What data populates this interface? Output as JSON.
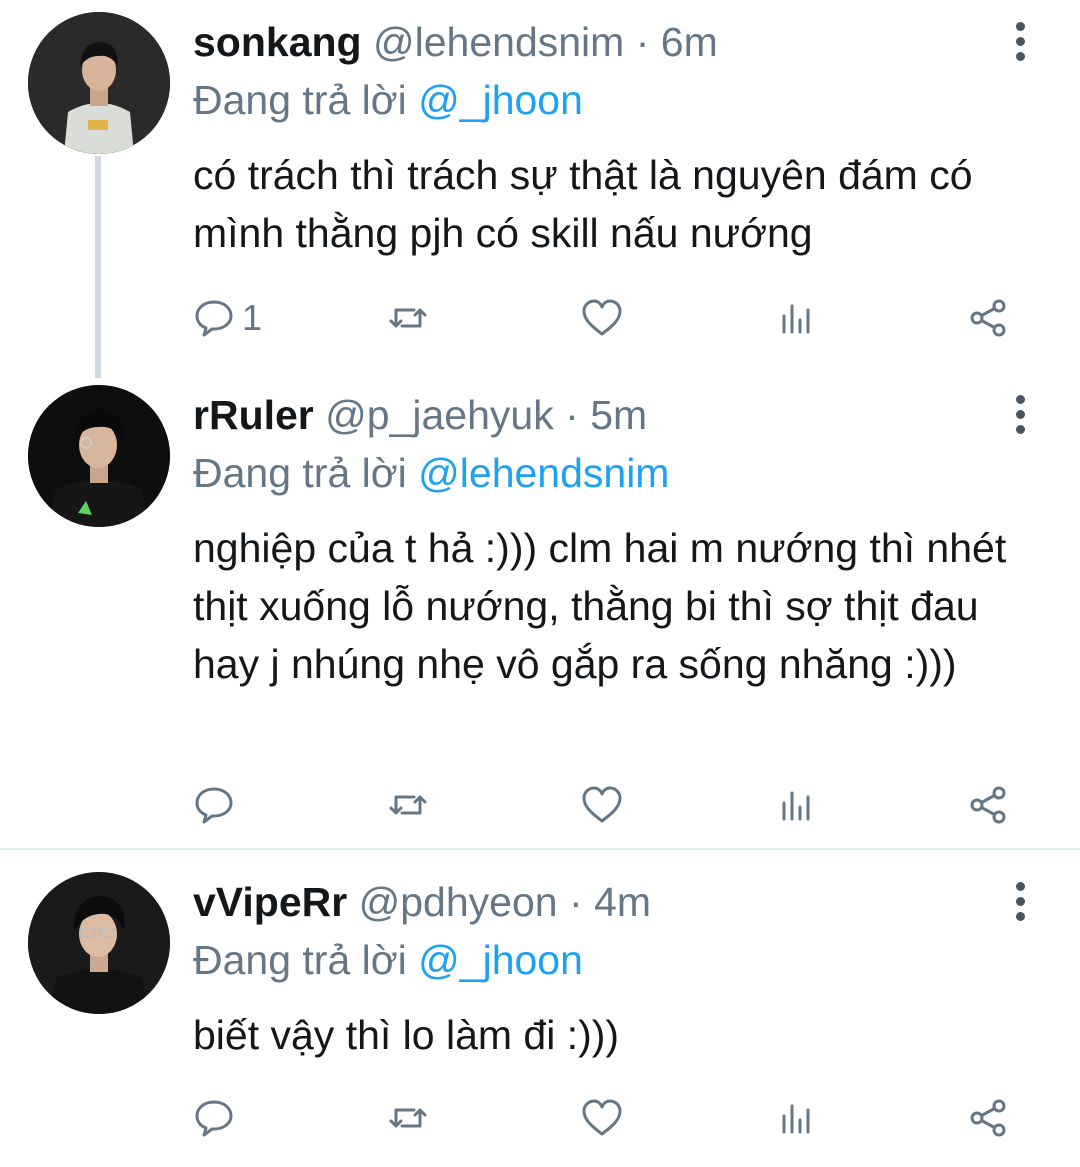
{
  "tweets": [
    {
      "name": "sonkang",
      "handle": "@lehendsnim",
      "dot": "·",
      "time": "6m",
      "replying_prefix": "Đang trả lời",
      "replying_to": "@_jhoon",
      "text": "có trách thì trách sự thật là nguyên đám có mình thằng pjh có skill nấu nướng",
      "reply_count": "1"
    },
    {
      "name": "rRuler",
      "handle": "@p_jaehyuk",
      "dot": "·",
      "time": "5m",
      "replying_prefix": "Đang trả lời",
      "replying_to": "@lehendsnim",
      "text": "nghiệp của t hả :))) clm hai m nướng thì nhét thịt xuống lỗ nướng, thằng bi thì sợ thịt đau hay j nhúng nhẹ vô gắp ra sống nhăng :)))",
      "reply_count": ""
    },
    {
      "name": "vVipeRr",
      "handle": "@pdhyeon",
      "dot": "·",
      "time": "4m",
      "replying_prefix": "Đang trả lời",
      "replying_to": "@_jhoon",
      "text": "biết vậy thì lo làm đi :)))",
      "reply_count": ""
    }
  ],
  "icons": [
    "reply-icon",
    "retweet-icon",
    "like-icon",
    "analytics-icon",
    "share-icon",
    "more-icon"
  ],
  "colors": {
    "link": "#1da1f2",
    "secondary_text": "#657786",
    "icon": "#657786",
    "thread_line": "#cfd9de",
    "separator": "#e1e8ed"
  }
}
